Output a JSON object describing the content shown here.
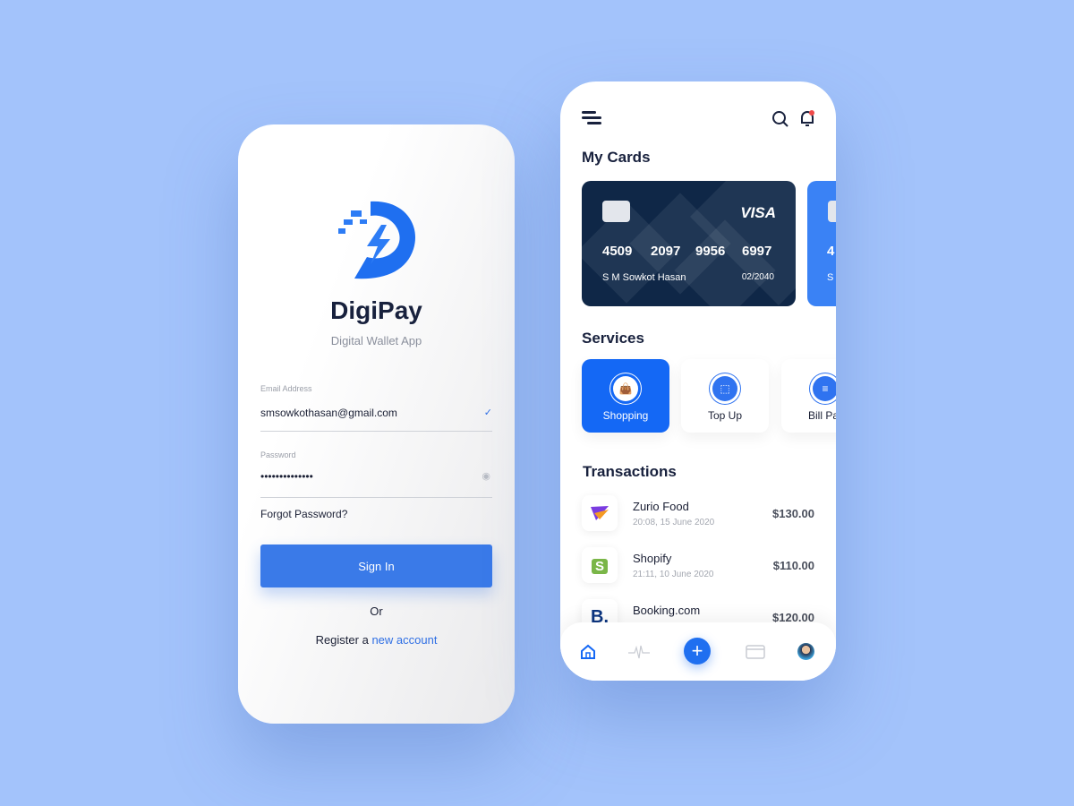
{
  "login": {
    "app_name": "DigiPay",
    "subtitle": "Digital Wallet App",
    "email_label": "Email Address",
    "email_value": "smsowkothasan@gmail.com",
    "password_label": "Password",
    "password_value": "••••••••••••••",
    "forgot": "Forgot Password?",
    "sign_in": "Sign In",
    "or": "Or",
    "register_prefix": "Register a ",
    "register_link": "new account"
  },
  "home": {
    "my_cards": "My Cards",
    "card": {
      "brand": "VISA",
      "groups": [
        "4509",
        "2097",
        "9956",
        "6997"
      ],
      "holder": "S M Sowkot Hasan",
      "expiry": "02/2040"
    },
    "card2": {
      "num_partial": "4",
      "holder_partial": "S"
    },
    "services_title": "Services",
    "services": [
      {
        "label": "Shopping",
        "icon": "shopping-bag-icon"
      },
      {
        "label": "Top Up",
        "icon": "topup-icon"
      },
      {
        "label": "Bill Pa",
        "icon": "bill-icon"
      }
    ],
    "transactions_title": "Transactions",
    "transactions": [
      {
        "name": "Zurio Food",
        "date": "20:08, 15 June 2020",
        "amount": "$130.00"
      },
      {
        "name": "Shopify",
        "date": "21:11, 10 June 2020",
        "amount": "$110.00",
        "logo": "S"
      },
      {
        "name": "Booking.com",
        "amount": "$120.00",
        "logo": "B."
      }
    ],
    "nav": [
      "home-icon",
      "activity-icon",
      "add-icon",
      "card-icon",
      "avatar"
    ]
  },
  "colors": {
    "background": "#a3c3fb",
    "primary": "#1468f5",
    "card_dark": "#0f2747"
  }
}
